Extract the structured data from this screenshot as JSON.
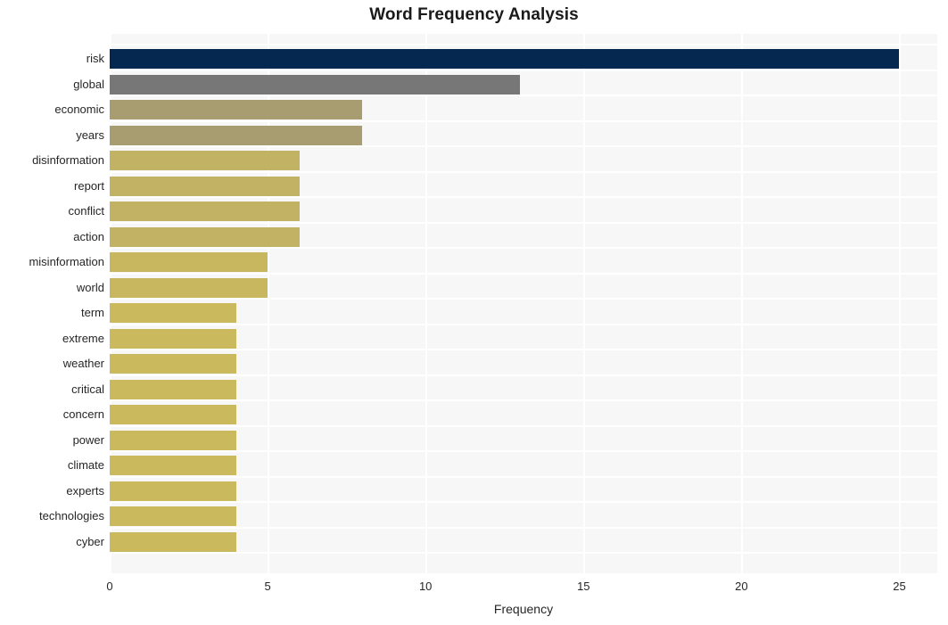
{
  "chart_data": {
    "type": "bar",
    "orientation": "horizontal",
    "title": "Word Frequency Analysis",
    "xlabel": "Frequency",
    "ylabel": "",
    "xlim": [
      0,
      26.2
    ],
    "xticks": [
      0,
      5,
      10,
      15,
      20,
      25
    ],
    "xtick_labels": [
      "0",
      "5",
      "10",
      "15",
      "20",
      "25"
    ],
    "grid": true,
    "legend": false,
    "categories": [
      "risk",
      "global",
      "economic",
      "years",
      "disinformation",
      "report",
      "conflict",
      "action",
      "misinformation",
      "world",
      "term",
      "extreme",
      "weather",
      "critical",
      "concern",
      "power",
      "climate",
      "experts",
      "technologies",
      "cyber"
    ],
    "values": [
      25,
      13,
      8,
      8,
      6,
      6,
      6,
      6,
      5,
      5,
      4,
      4,
      4,
      4,
      4,
      4,
      4,
      4,
      4,
      4
    ],
    "bar_colors": [
      "#04284f",
      "#777777",
      "#a89d71",
      "#a89d71",
      "#c2b263",
      "#c2b263",
      "#c2b263",
      "#c2b263",
      "#c8b75f",
      "#c8b75f",
      "#cbba5d",
      "#cbba5d",
      "#cbba5d",
      "#cbba5d",
      "#cbba5d",
      "#cbba5d",
      "#cbba5d",
      "#cbba5d",
      "#cbba5d",
      "#cbba5d"
    ],
    "plot_background": "#f7f7f7",
    "grid_color": "#ffffff",
    "figure_background": "#ffffff",
    "text_color": "#262626"
  }
}
